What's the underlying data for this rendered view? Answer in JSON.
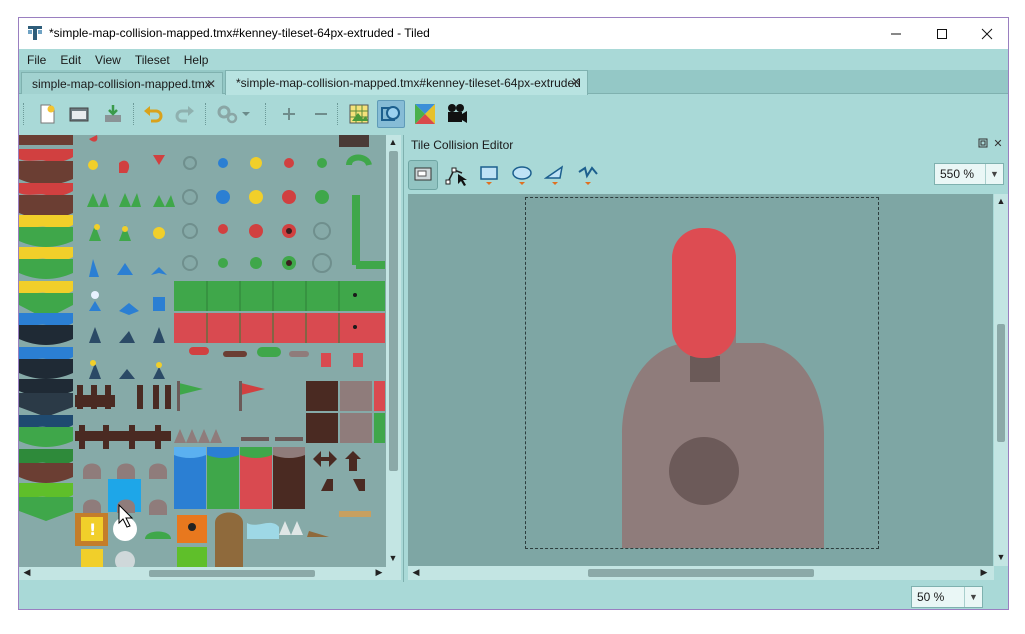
{
  "window": {
    "title": "*simple-map-collision-mapped.tmx#kenney-tileset-64px-extruded - Tiled",
    "controls": {
      "minimize": "minimize-icon",
      "maximize": "maximize-icon",
      "close": "close-icon"
    }
  },
  "menu": [
    "File",
    "Edit",
    "View",
    "Tileset",
    "Help"
  ],
  "tabs": [
    {
      "label": "simple-map-collision-mapped.tmx",
      "active": false
    },
    {
      "label": "*simple-map-collision-mapped.tmx#kenney-tileset-64px-extruded",
      "active": true
    }
  ],
  "toolbar": {
    "icons": [
      "new-file-icon",
      "open-file-icon",
      "save-file-icon",
      "undo-icon",
      "redo-icon",
      "settings-dropdown-icon",
      "add-icon",
      "remove-icon",
      "tileset-image-icon",
      "collision-editor-icon",
      "terrain-icon",
      "animation-icon"
    ]
  },
  "collision_editor": {
    "title": "Tile Collision Editor",
    "tools": [
      "select-objects-icon",
      "edit-polygons-icon",
      "rectangle-icon",
      "ellipse-icon",
      "polygon-icon",
      "polyline-icon"
    ],
    "zoom": "550 %"
  },
  "status": {
    "zoom": "50 %"
  },
  "colors": {
    "accent": "#a9d9d7",
    "window_border": "#9a7fc0",
    "collision_shape": "#dd4c52",
    "tile_body": "#8f7c7b",
    "tile_neck": "#6b5a58",
    "tile_hole": "#6c5a59"
  }
}
